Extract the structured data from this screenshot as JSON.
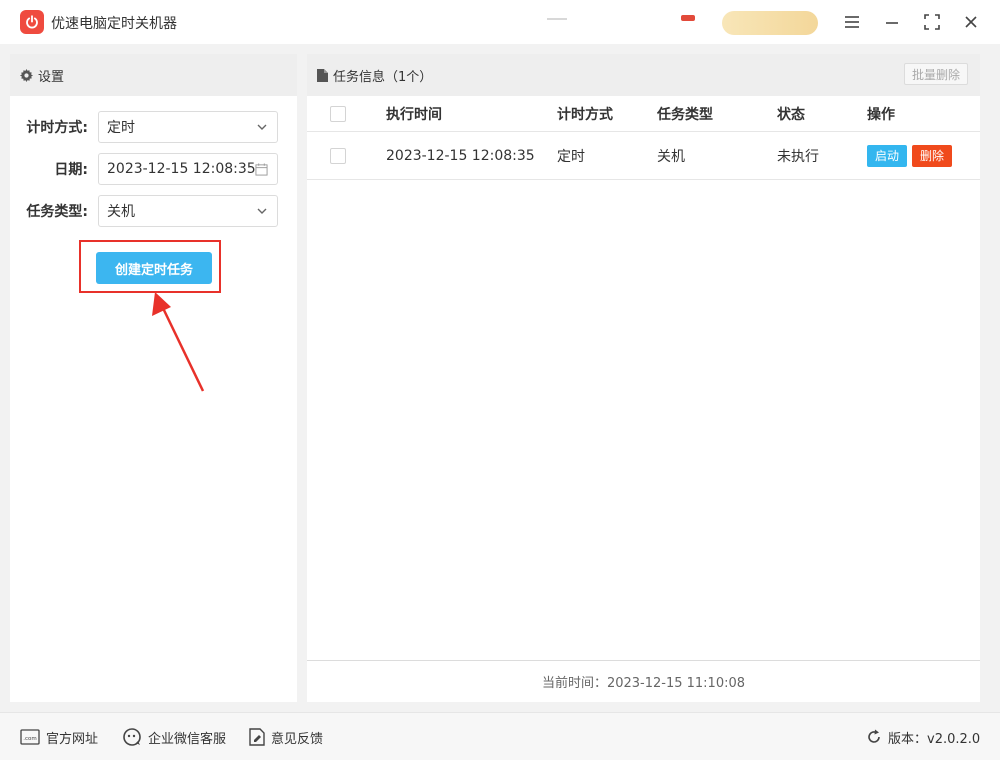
{
  "app": {
    "title": "优速电脑定时关机器"
  },
  "settings": {
    "header": "设置",
    "timing_mode_label": "计时方式:",
    "timing_mode_value": "定时",
    "date_label": "日期:",
    "date_value": "2023-12-15 12:08:35",
    "task_type_label": "任务类型:",
    "task_type_value": "关机",
    "create_button": "创建定时任务"
  },
  "tasks": {
    "header": "任务信息（1个）",
    "batch_delete": "批量删除",
    "columns": {
      "exec_time": "执行时间",
      "timing_mode": "计时方式",
      "task_type": "任务类型",
      "status": "状态",
      "actions": "操作"
    },
    "rows": [
      {
        "exec_time": "2023-12-15 12:08:35",
        "timing_mode": "定时",
        "task_type": "关机",
        "status": "未执行",
        "start_label": "启动",
        "delete_label": "删除"
      }
    ],
    "current_time": "当前时间：2023-12-15 11:10:08"
  },
  "footer": {
    "website": "官方网址",
    "wechat_service": "企业微信客服",
    "feedback": "意见反馈",
    "version": "版本：v2.0.2.0"
  },
  "colors": {
    "accent_blue": "#3cb6f0",
    "delete_red": "#f04a1c",
    "highlight_red": "#e8312a",
    "logo_red": "#ef4b3f"
  },
  "icons": {
    "logo": "power-icon",
    "settings": "gear-icon",
    "tasks": "document-icon",
    "date": "calendar-icon",
    "dropdown": "chevron-down-icon",
    "menu": "menu-icon",
    "minimize": "minimize-icon",
    "maximize": "maximize-icon",
    "close": "close-icon",
    "website": "web-icon",
    "wechat": "wechat-icon",
    "feedback": "feedback-icon",
    "version": "refresh-icon"
  }
}
